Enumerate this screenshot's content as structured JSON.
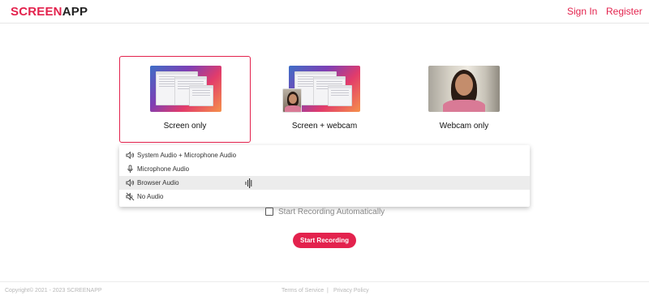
{
  "header": {
    "logo_part1": "SCREEN",
    "logo_part2": "APP",
    "sign_in": "Sign In",
    "register": "Register"
  },
  "modes": [
    {
      "label": "Screen only",
      "selected": true
    },
    {
      "label": "Screen + webcam",
      "selected": false
    },
    {
      "label": "Webcam only",
      "selected": false
    }
  ],
  "audio_options": [
    {
      "label": "System Audio + Microphone Audio",
      "icon": "speaker-icon"
    },
    {
      "label": "Microphone Audio",
      "icon": "microphone-icon"
    },
    {
      "label": "Browser Audio",
      "icon": "speaker-icon",
      "highlighted": true
    },
    {
      "label": "No Audio",
      "icon": "speaker-muted-icon"
    }
  ],
  "auto_record": {
    "label": "Start Recording Automatically",
    "checked": false
  },
  "start_button": "Start Recording",
  "footer": {
    "copyright": "Copyright©  2021 - 2023 SCREENAPP",
    "terms": "Terms of Service",
    "separator": "|",
    "privacy": "Privacy Policy"
  },
  "colors": {
    "accent": "#e3224d"
  }
}
